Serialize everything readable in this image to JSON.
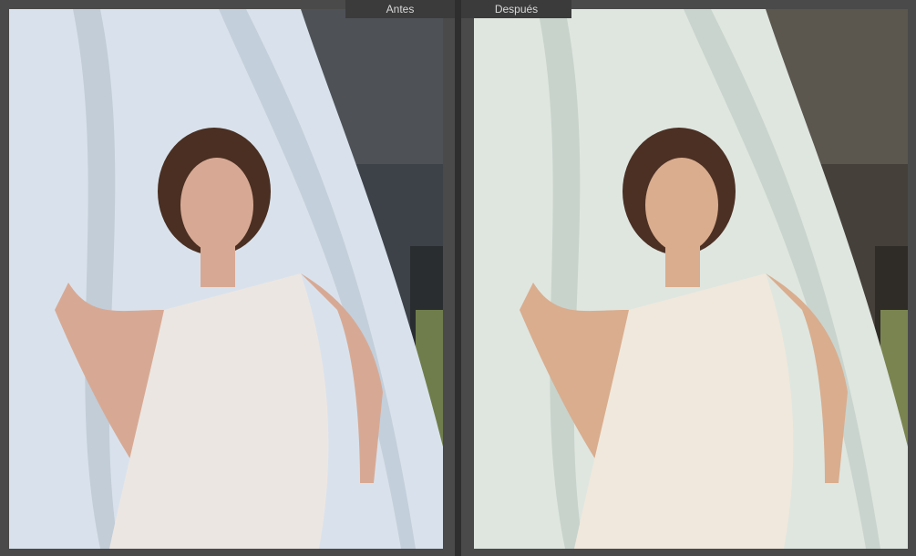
{
  "labels": {
    "before": "Antes",
    "after": "Después"
  },
  "panes": {
    "before": {
      "curtain": "#d9e2ec",
      "curtain_shadow": "#aebbc9",
      "background": "#3d4148",
      "skin": "#d7a994",
      "dress": "#ece6e2",
      "hair": "#4a2f22"
    },
    "after": {
      "curtain": "#dfe6e0",
      "curtain_shadow": "#b5c2bb",
      "background": "#454039",
      "skin": "#d9ad8e",
      "dress": "#f0e8dc",
      "hair": "#4c3024"
    }
  }
}
